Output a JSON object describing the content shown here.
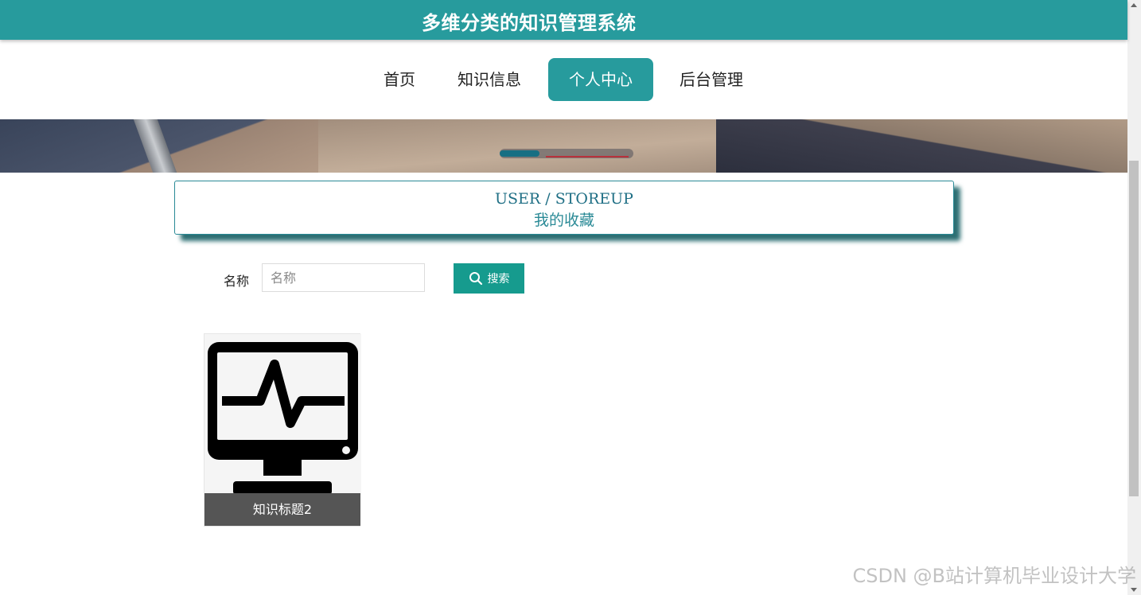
{
  "header": {
    "title": "多维分类的知识管理系统"
  },
  "nav": {
    "items": [
      {
        "label": "首页"
      },
      {
        "label": "知识信息"
      },
      {
        "label": "个人中心"
      },
      {
        "label": "后台管理"
      }
    ],
    "active_index": 2
  },
  "section": {
    "title_en": "USER / STOREUP",
    "title_cn": "我的收藏"
  },
  "search": {
    "label": "名称",
    "placeholder": "名称",
    "value": "",
    "button_label": "搜索"
  },
  "cards": [
    {
      "title": "知识标题2",
      "icon": "monitor-heartbeat-icon"
    }
  ],
  "watermark": "CSDN @B站计算机毕业设计大学",
  "colors": {
    "primary": "#279b9d",
    "button": "#169b8e",
    "card_caption": "#555555"
  }
}
